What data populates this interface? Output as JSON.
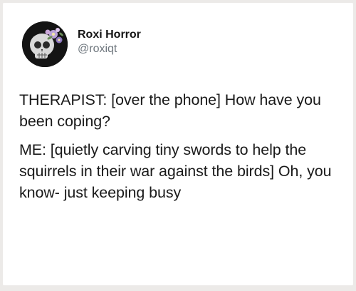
{
  "user": {
    "display_name": "Roxi Horror",
    "handle": "@roxiqt"
  },
  "avatar_icon": "skull-with-flowers-icon",
  "tweet": {
    "paragraphs": [
      "THERAPIST: [over the phone] How have you been coping?",
      "ME: [quietly carving tiny swords to help the squirrels in their war against the birds] Oh, you know- just keeping busy"
    ]
  }
}
